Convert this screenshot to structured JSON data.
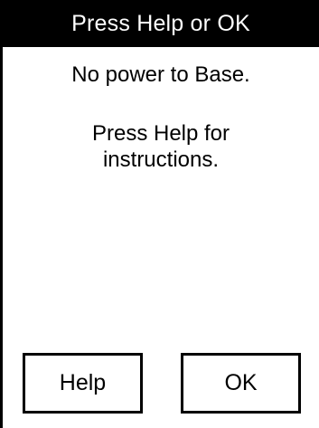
{
  "dialog": {
    "title": "Press Help or OK",
    "message": "No power to Base.",
    "instruction": "Press Help for instructions."
  },
  "buttons": {
    "help_label": "Help",
    "ok_label": "OK"
  },
  "colors": {
    "title_bar_background": "#000000",
    "title_text": "#ffffff",
    "background": "#ffffff",
    "text": "#000000"
  }
}
